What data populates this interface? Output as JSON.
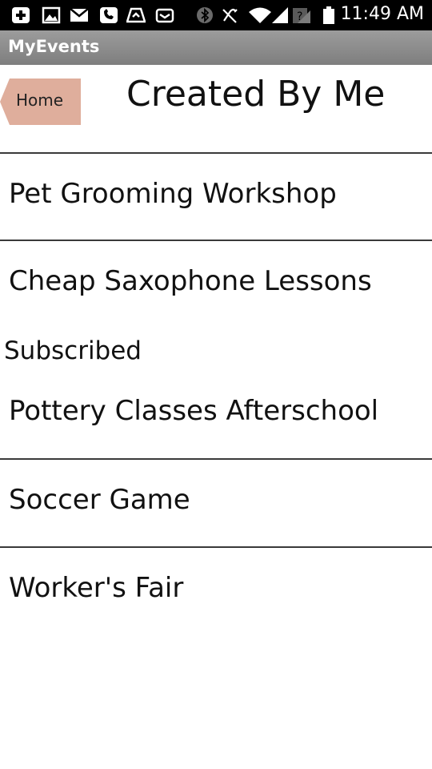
{
  "status_bar": {
    "time": "11:49 AM",
    "icons": [
      "add-notification-icon",
      "image-icon",
      "gmail-icon",
      "voicemail-icon",
      "upload-icon",
      "email-icon",
      "bluetooth-icon",
      "mute-icon",
      "wifi-icon",
      "signal-icon",
      "no-sim-icon",
      "battery-icon"
    ]
  },
  "app": {
    "title": "MyEvents"
  },
  "header": {
    "home_label": "Home",
    "page_title": "Created By Me",
    "home_button_color": "#dfae9c"
  },
  "created_events": [
    {
      "label": "Pet Grooming Workshop"
    },
    {
      "label": "Cheap Saxophone Lessons"
    }
  ],
  "subscribed": {
    "header": "Subscribed",
    "events": [
      {
        "label": "Pottery Classes Afterschool"
      },
      {
        "label": "Soccer Game"
      },
      {
        "label": "Worker's Fair"
      }
    ]
  }
}
